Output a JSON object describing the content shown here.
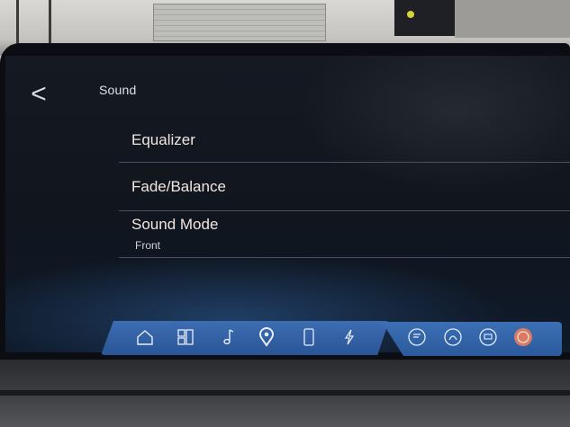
{
  "header": {
    "back_glyph": "<",
    "title": "Sound"
  },
  "menu": [
    {
      "label": "Equalizer"
    },
    {
      "label": "Fade/Balance"
    },
    {
      "label": "Sound Mode",
      "value": "Front"
    }
  ],
  "nav_icons": [
    "home-icon",
    "apps-grid-icon",
    "music-note-icon",
    "location-pin-icon",
    "phone-icon",
    "charging-icon",
    "climate-off-icon",
    "seat-heat-icon",
    "defrost-icon",
    "steering-heat-icon"
  ],
  "colors": {
    "accent": "#3d6db2",
    "menu_text": "#f0e6e0"
  }
}
